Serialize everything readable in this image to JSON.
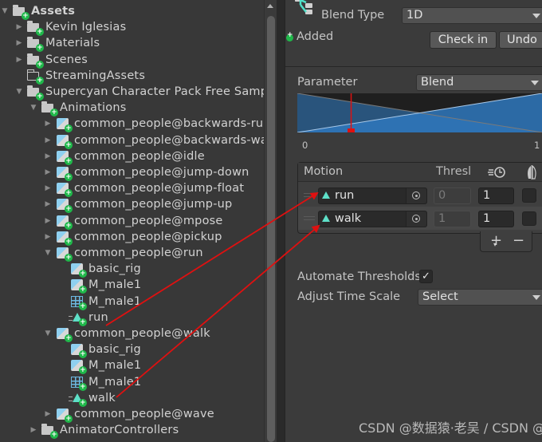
{
  "project_tree": {
    "items": [
      {
        "label": "Assets",
        "icon": "folder-open-icon",
        "expanded": true,
        "depth": 0
      },
      {
        "label": "Kevin Iglesias",
        "icon": "folder-icon",
        "expanded": false,
        "depth": 1
      },
      {
        "label": "Materials",
        "icon": "folder-icon",
        "expanded": false,
        "depth": 1
      },
      {
        "label": "Scenes",
        "icon": "folder-icon",
        "expanded": false,
        "depth": 1
      },
      {
        "label": "StreamingAssets",
        "icon": "folder-empty-icon",
        "expanded": null,
        "depth": 1
      },
      {
        "label": "Supercyan Character Pack Free Samp",
        "icon": "folder-open-icon",
        "expanded": true,
        "depth": 1
      },
      {
        "label": "Animations",
        "icon": "folder-open-icon",
        "expanded": true,
        "depth": 2
      },
      {
        "label": "common_people@backwards-run",
        "icon": "model-icon",
        "expanded": false,
        "depth": 3
      },
      {
        "label": "common_people@backwards-wa",
        "icon": "model-icon",
        "expanded": false,
        "depth": 3
      },
      {
        "label": "common_people@idle",
        "icon": "model-icon",
        "expanded": false,
        "depth": 3
      },
      {
        "label": "common_people@jump-down",
        "icon": "model-icon",
        "expanded": false,
        "depth": 3
      },
      {
        "label": "common_people@jump-float",
        "icon": "model-icon",
        "expanded": false,
        "depth": 3
      },
      {
        "label": "common_people@jump-up",
        "icon": "model-icon",
        "expanded": false,
        "depth": 3
      },
      {
        "label": "common_people@mpose",
        "icon": "model-icon",
        "expanded": false,
        "depth": 3
      },
      {
        "label": "common_people@pickup",
        "icon": "model-icon",
        "expanded": false,
        "depth": 3
      },
      {
        "label": "common_people@run",
        "icon": "model-icon",
        "expanded": true,
        "depth": 3
      },
      {
        "label": "basic_rig",
        "icon": "model-icon",
        "expanded": null,
        "depth": 4
      },
      {
        "label": "M_male1",
        "icon": "model-icon",
        "expanded": null,
        "depth": 4
      },
      {
        "label": "M_male1",
        "icon": "mesh-icon",
        "expanded": null,
        "depth": 4
      },
      {
        "label": "run",
        "icon": "animation-clip-icon",
        "expanded": null,
        "depth": 4
      },
      {
        "label": "common_people@walk",
        "icon": "model-icon",
        "expanded": true,
        "depth": 3
      },
      {
        "label": "basic_rig",
        "icon": "model-icon",
        "expanded": null,
        "depth": 4
      },
      {
        "label": "M_male1",
        "icon": "model-icon",
        "expanded": null,
        "depth": 4
      },
      {
        "label": "M_male1",
        "icon": "mesh-icon",
        "expanded": null,
        "depth": 4
      },
      {
        "label": "walk",
        "icon": "animation-clip-icon",
        "expanded": null,
        "depth": 4
      },
      {
        "label": "common_people@wave",
        "icon": "model-icon",
        "expanded": false,
        "depth": 3
      },
      {
        "label": "AnimatorControllers",
        "icon": "folder-icon",
        "expanded": false,
        "depth": 2
      }
    ]
  },
  "inspector": {
    "blend_type_label": "Blend Type",
    "blend_type_value": "1D",
    "vcs_status": "Added",
    "check_in_label": "Check in",
    "undo_label": "Undo",
    "parameter_label": "Parameter",
    "parameter_value": "Blend",
    "graph": {
      "min_label": "0",
      "max_label": "1",
      "current_value": 0.22
    },
    "motion_table": {
      "headers": {
        "motion": "Motion",
        "threshold": "Thresl",
        "time_scale_icon": "clock-speed-icon",
        "mirror_icon": "mirror-icon"
      },
      "rows": [
        {
          "motion": "run",
          "threshold": "0",
          "time_scale": "1",
          "mirror": false
        },
        {
          "motion": "walk",
          "threshold": "1",
          "time_scale": "1",
          "mirror": false
        }
      ],
      "add_label": "+",
      "remove_label": "−"
    },
    "automate_threshold_label": "Automate Thresholds",
    "automate_threshold_checked": true,
    "adjust_time_scale_label": "Adjust Time Scale",
    "adjust_time_scale_value": "Select"
  },
  "colors": {
    "accent_added": "#1fb84a",
    "annotation_arrow": "#e01010",
    "blend_fill": "#2d6fab"
  },
  "watermark": "CSDN @数据猿·老吴 / CSDN @yang_hello"
}
